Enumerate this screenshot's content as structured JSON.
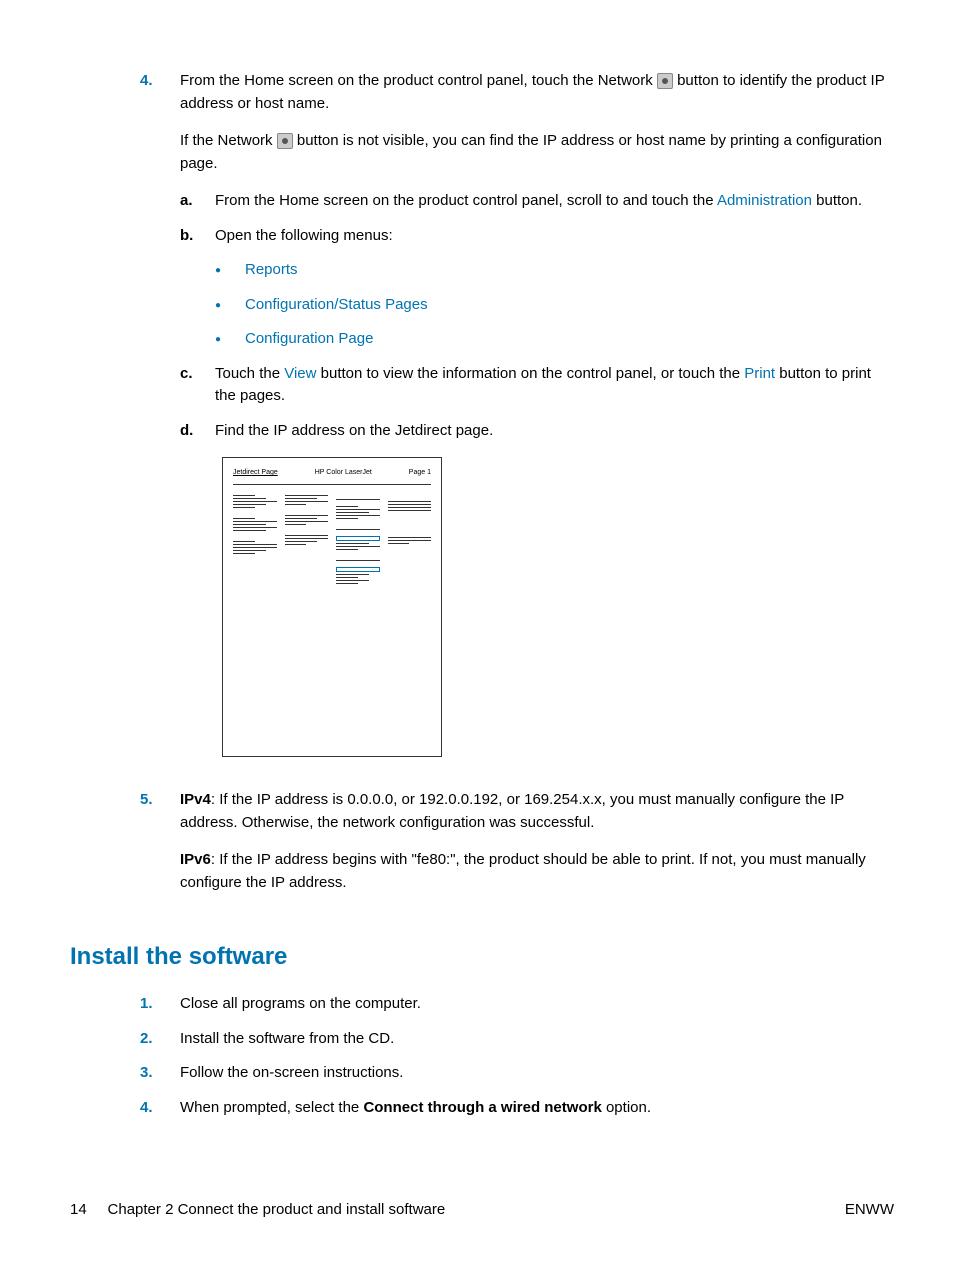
{
  "step4": {
    "num": "4.",
    "text_part1": "From the Home screen on the product control panel, touch the Network ",
    "text_part2": " button to identify the product IP address or host name.",
    "para2_part1": "If the Network ",
    "para2_part2": " button is not visible, you can find the IP address or host name by printing a configuration page.",
    "sub_a": {
      "marker": "a.",
      "text1": "From the Home screen on the product control panel, scroll to and touch the ",
      "link": "Administration",
      "text2": " button."
    },
    "sub_b": {
      "marker": "b.",
      "text": "Open the following menus:"
    },
    "bullets": [
      "Reports",
      "Configuration/Status Pages",
      "Configuration Page"
    ],
    "sub_c": {
      "marker": "c.",
      "text1": "Touch the ",
      "link1": "View",
      "text2": " button to view the information on the control panel, or touch the ",
      "link2": "Print",
      "text3": " button to print the pages."
    },
    "sub_d": {
      "marker": "d.",
      "text": "Find the IP address on the Jetdirect page."
    }
  },
  "jetdirect": {
    "title": "Jetdirect Page",
    "model": "HP Color LaserJet",
    "page": "Page 1"
  },
  "step5": {
    "num": "5.",
    "ipv4_label": "IPv4",
    "ipv4_text": ": If the IP address is 0.0.0.0, or 192.0.0.192, or 169.254.x.x, you must manually configure the IP address. Otherwise, the network configuration was successful.",
    "ipv6_label": "IPv6",
    "ipv6_text": ": If the IP address begins with \"fe80:\", the product should be able to print. If not, you must manually configure the IP address."
  },
  "section2": {
    "heading": "Install the software",
    "steps": [
      {
        "num": "1.",
        "text": "Close all programs on the computer."
      },
      {
        "num": "2.",
        "text": "Install the software from the CD."
      },
      {
        "num": "3.",
        "text": "Follow the on-screen instructions."
      }
    ],
    "step4": {
      "num": "4.",
      "text1": "When prompted, select the ",
      "bold": "Connect through a wired network",
      "text2": " option."
    }
  },
  "footer": {
    "page_num": "14",
    "chapter": "Chapter 2   Connect the product and install software",
    "right": "ENWW"
  }
}
